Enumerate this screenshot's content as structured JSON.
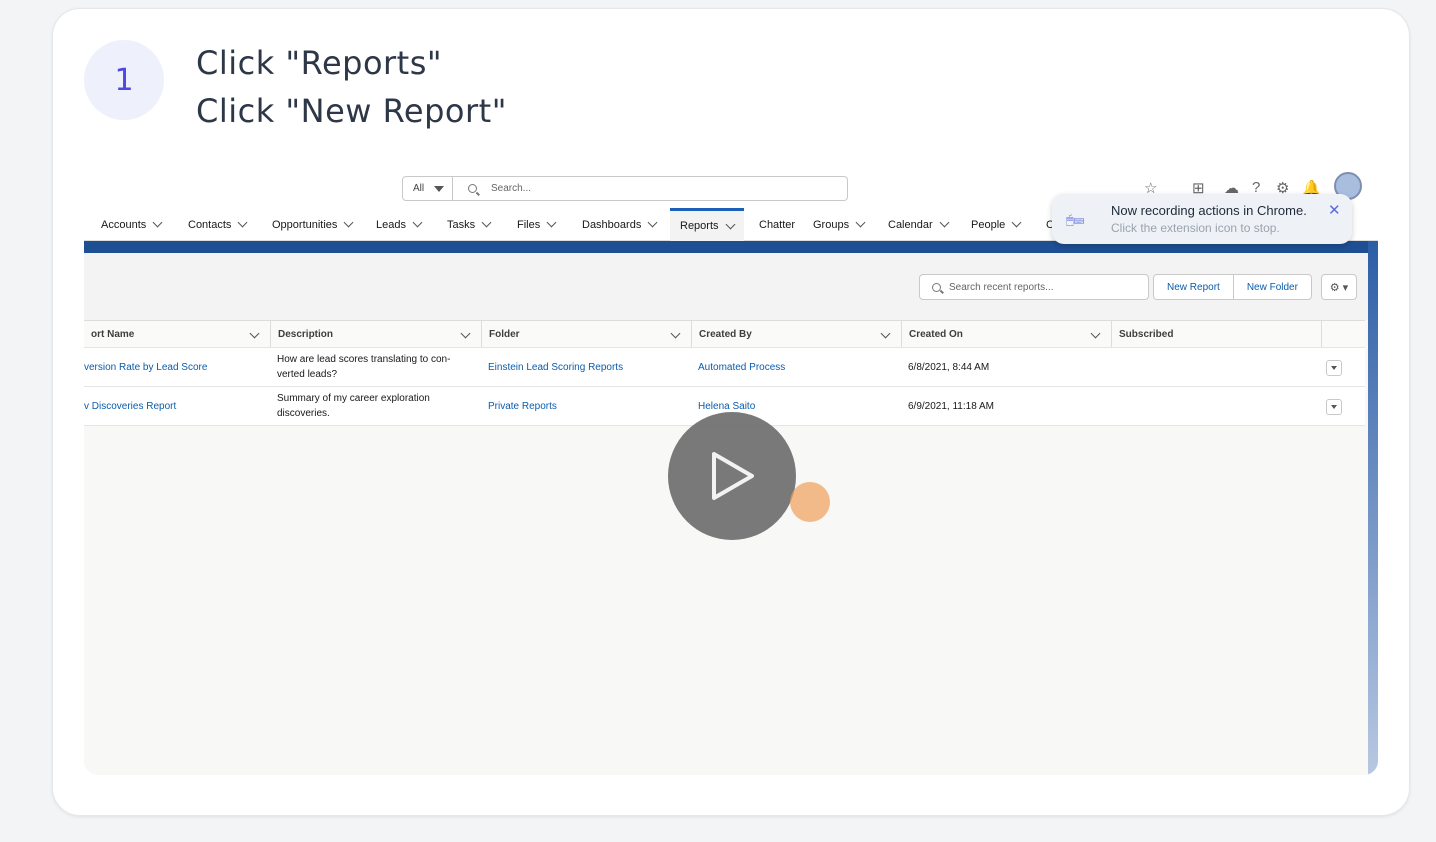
{
  "step": {
    "number": "1",
    "lines": [
      "Click \"Reports\"",
      "Click \"New Report\""
    ]
  },
  "screenshot": {
    "search": {
      "scope": "All",
      "placeholder": "Search..."
    },
    "nav": [
      "Accounts",
      "Contacts",
      "Opportunities",
      "Leads",
      "Tasks",
      "Files",
      "Dashboards",
      "Reports",
      "Chatter",
      "Groups",
      "Calendar",
      "People",
      "C"
    ],
    "active_nav": "Reports",
    "toast": {
      "title": "Now recording actions in Chrome.",
      "subtitle": "Click the extension icon to stop.",
      "close": "✕",
      "icon": "🖱⌨"
    },
    "list": {
      "search_placeholder": "Search recent reports...",
      "new_report": "New Report",
      "new_folder": "New Folder",
      "settings_icon": "⚙ ▾"
    },
    "columns": [
      "ort Name",
      "Description",
      "Folder",
      "Created By",
      "Created On",
      "Subscribed"
    ],
    "rows": [
      {
        "name": "version Rate by Lead Score",
        "description": "How are lead scores translating to con-verted leads?",
        "folder": "Einstein Lead Scoring Reports",
        "created_by": "Automated Process",
        "created_on": "6/8/2021, 8:44 AM",
        "subscribed": ""
      },
      {
        "name": "v Discoveries Report",
        "description": "Summary of my career exploration discoveries.",
        "folder": "Private Reports",
        "created_by": "Helena Saito",
        "created_on": "6/9/2021, 11:18 AM",
        "subscribed": ""
      }
    ]
  },
  "colors": {
    "accent": "#4f46e5",
    "link": "#0b5cab",
    "brand_band": "#1e4f93",
    "click_marker": "#f0a05a"
  }
}
